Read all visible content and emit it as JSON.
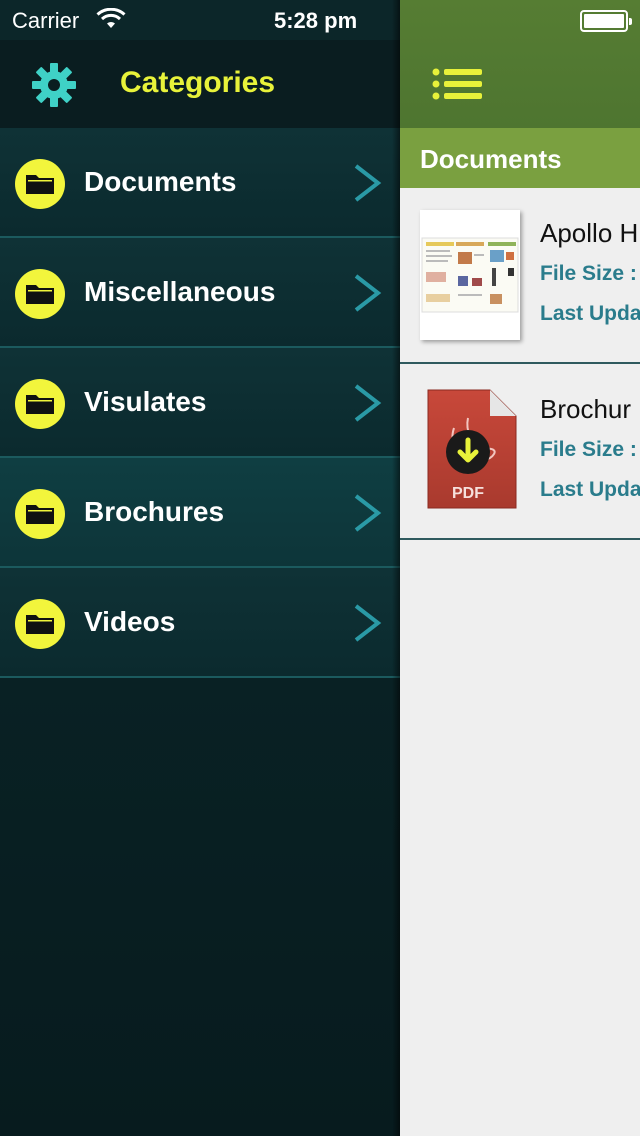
{
  "status_bar": {
    "carrier": "Carrier",
    "time": "5:28 pm"
  },
  "drawer": {
    "title": "Categories",
    "items": [
      {
        "label": "Documents"
      },
      {
        "label": "Miscellaneous"
      },
      {
        "label": "Visulates"
      },
      {
        "label": "Brochures"
      },
      {
        "label": "Videos"
      }
    ],
    "active_item": "Brochures"
  },
  "main": {
    "section_title": "Documents",
    "documents": [
      {
        "name": "Apollo H",
        "file_size": "File Size :",
        "last_updated": "Last Upda"
      },
      {
        "name": "Brochur",
        "file_size": "File Size :",
        "last_updated": "Last Upda",
        "thumb_label": "PDF"
      }
    ]
  },
  "colors": {
    "accent_yellow": "#e8f23a",
    "header_green": "#567d33",
    "section_green": "#7aa040",
    "link_teal": "#2a7c8c"
  },
  "icons": [
    "wifi-icon",
    "battery-icon",
    "gear-icon",
    "folder-icon",
    "chevron-right-icon",
    "menu-icon",
    "pdf-icon"
  ]
}
